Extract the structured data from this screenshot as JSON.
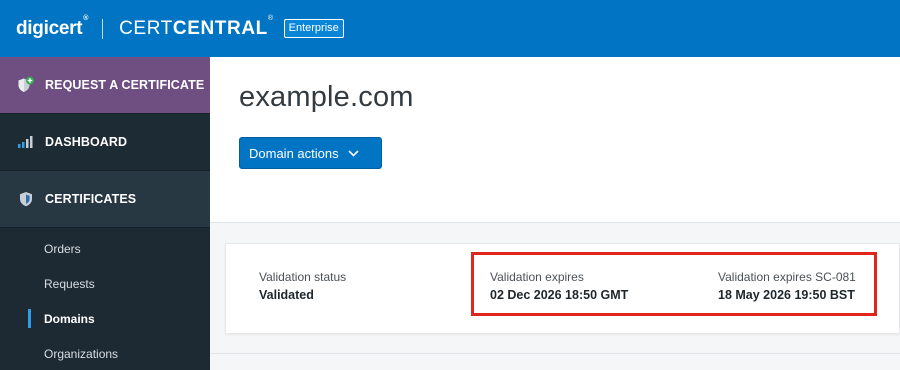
{
  "header": {
    "brand": "digicert",
    "brand_mark": "®",
    "product_light": "CERT",
    "product_bold": "CENTRAL",
    "product_mark": "®",
    "edition": "Enterprise",
    "background_color": "#0174c3"
  },
  "sidebar": {
    "main_items": [
      {
        "label": "REQUEST A CERTIFICATE",
        "icon": "shield-plus-icon",
        "color": "#6f4e82"
      },
      {
        "label": "DASHBOARD",
        "icon": "bar-chart-icon"
      },
      {
        "label": "CERTIFICATES",
        "icon": "shield-icon"
      }
    ],
    "sub_items": [
      {
        "label": "Orders",
        "active": false
      },
      {
        "label": "Requests",
        "active": false
      },
      {
        "label": "Domains",
        "active": true
      },
      {
        "label": "Organizations",
        "active": false
      }
    ]
  },
  "main": {
    "title": "example.com",
    "actions_button": {
      "label": "Domain actions",
      "icon": "chevron-down-icon"
    },
    "validation": {
      "status_label": "Validation status",
      "status_value": "Validated",
      "expires_label": "Validation expires",
      "expires_value": "02 Dec 2026 18:50 GMT",
      "expires_sc_label": "Validation expires SC-081",
      "expires_sc_value": "18 May 2026 19:50 BST",
      "highlight_color": "#e0261a"
    }
  }
}
